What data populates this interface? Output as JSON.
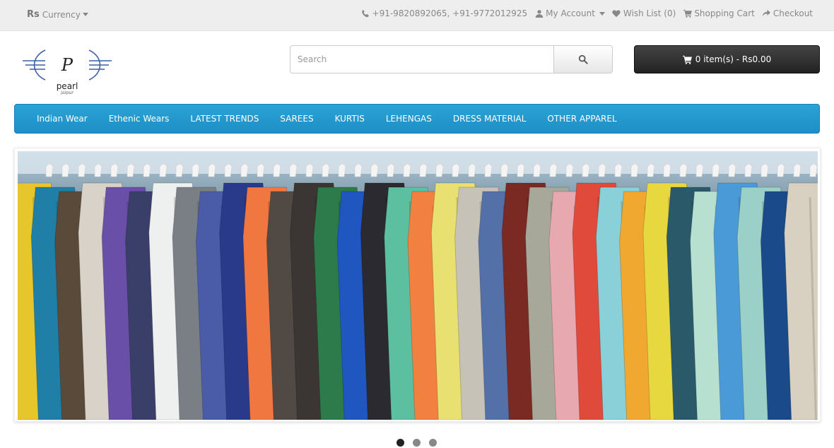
{
  "topbar": {
    "currency_symbol": "Rs",
    "currency_label": "Currency",
    "phone": "+91-9820892065, +91-9772012925",
    "my_account": "My Account",
    "wish_list": "Wish List (0)",
    "shopping_cart": "Shopping Cart",
    "checkout": "Checkout"
  },
  "logo": {
    "text": "pearl",
    "subtext": "jaipur",
    "letter": "P"
  },
  "search": {
    "placeholder": "Search",
    "value": ""
  },
  "cart": {
    "label": "0 item(s) - Rs0.00"
  },
  "menu": {
    "items": [
      "Indian Wear",
      "Ethenic Wears",
      "LATEST TRENDS",
      "SAREES",
      "KURTIS",
      "LEHENGAS",
      "DRESS MATERIAL",
      "OTHER APPAREL"
    ]
  },
  "slideshow": {
    "slides": 3,
    "active_slide": 1
  },
  "colors": {
    "menu": "#229ad0",
    "cart_button": "#333333",
    "topbar": "#eeeeee"
  }
}
